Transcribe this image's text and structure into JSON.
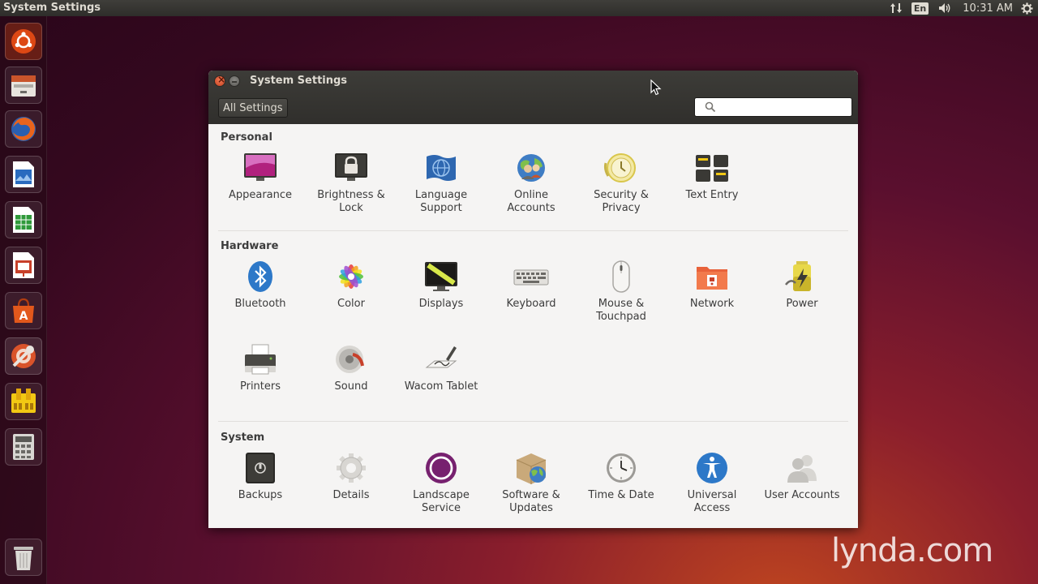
{
  "top_panel": {
    "app_title": "System Settings",
    "keyboard_layout": "En",
    "clock": "10:31 AM"
  },
  "window": {
    "title": "System Settings",
    "all_settings_label": "All Settings",
    "search_placeholder": ""
  },
  "sections": {
    "personal": {
      "title": "Personal",
      "items": [
        "Appearance",
        "Brightness &\nLock",
        "Language\nSupport",
        "Online\nAccounts",
        "Security &\nPrivacy",
        "Text Entry"
      ]
    },
    "hardware": {
      "title": "Hardware",
      "items": [
        "Bluetooth",
        "Color",
        "Displays",
        "Keyboard",
        "Mouse &\nTouchpad",
        "Network",
        "Power",
        "Printers",
        "Sound",
        "Wacom Tablet"
      ]
    },
    "system": {
      "title": "System",
      "items": [
        "Backups",
        "Details",
        "Landscape\nService",
        "Software &\nUpdates",
        "Time & Date",
        "Universal\nAccess",
        "User Accounts"
      ]
    }
  },
  "watermark": "lynda.com",
  "colors": {
    "ubuntu_orange": "#dd4814",
    "aubergine": "#77216f",
    "panel_dark": "#3c3b37"
  }
}
